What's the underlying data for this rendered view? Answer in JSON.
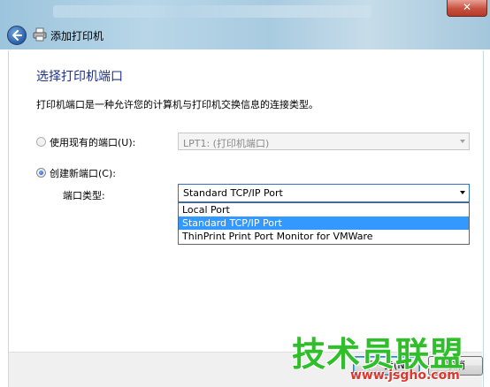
{
  "window": {
    "title": "添加打印机",
    "close_glyph": "✕"
  },
  "page": {
    "heading": "选择打印机端口",
    "description": "打印机端口是一种允许您的计算机与打印机交换信息的连接类型。"
  },
  "existing_port": {
    "radio_label": "使用现有的端口(U):",
    "selected_value": "LPT1: (打印机端口)",
    "checked": false
  },
  "new_port": {
    "radio_label": "创建新端口(C):",
    "checked": true,
    "type_label": "端口类型:",
    "selected_value": "Standard TCP/IP Port",
    "options": [
      "Local Port",
      "Standard TCP/IP Port",
      "ThinPrint Print Port Monitor for VMWare"
    ],
    "highlighted_index": 1
  },
  "buttons": {
    "next": "下一步(N)",
    "cancel": "取消"
  },
  "watermark": {
    "main": "技术员联盟",
    "url": "www.jsgho.com"
  },
  "icons": {
    "back": "back-arrow-icon",
    "printer": "printer-icon",
    "close": "close-icon"
  },
  "colors": {
    "heading": "#1e3287",
    "selection": "#3399ff",
    "watermark_main": "#2fbf2a",
    "watermark_url": "#e0352b"
  }
}
